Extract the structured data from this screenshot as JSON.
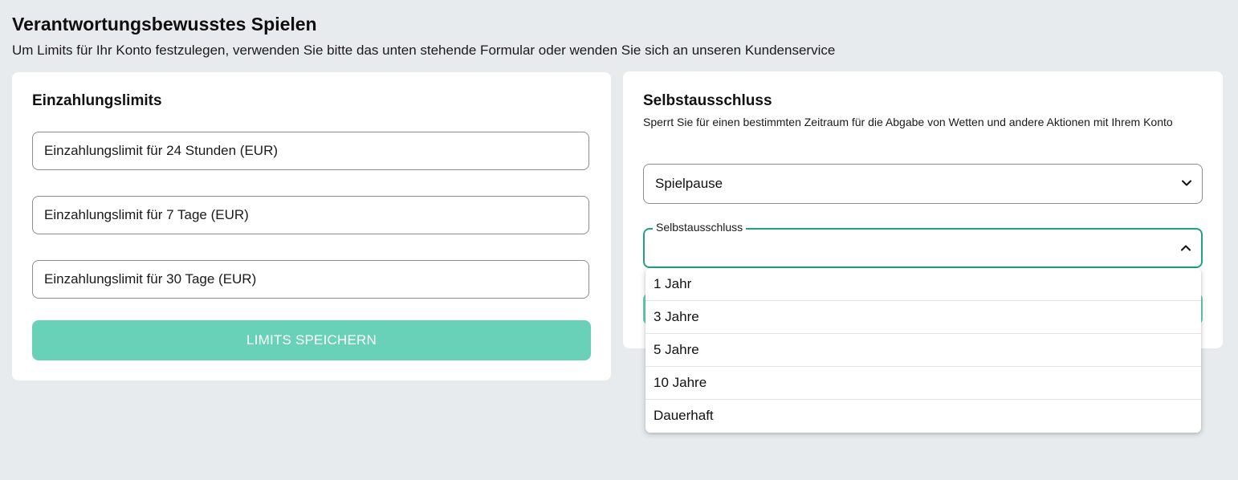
{
  "page": {
    "title": "Verantwortungsbewusstes Spielen",
    "subtitle": "Um Limits für Ihr Konto festzulegen, verwenden Sie bitte das unten stehende Formular oder wenden Sie sich an unseren Kundenservice"
  },
  "deposit_limits": {
    "title": "Einzahlungslimits",
    "fields": [
      {
        "placeholder": "Einzahlungslimit für 24 Stunden (EUR)",
        "value": ""
      },
      {
        "placeholder": "Einzahlungslimit für 7 Tage (EUR)",
        "value": ""
      },
      {
        "placeholder": "Einzahlungslimit für 30 Tage (EUR)",
        "value": ""
      }
    ],
    "save_label": "LIMITS SPEICHERN"
  },
  "self_exclusion": {
    "title": "Selbstausschluss",
    "description": "Sperrt Sie für einen bestimmten Zeitraum für die Abgabe von Wetten und andere Aktionen mit Ihrem Konto",
    "type_select": {
      "selected": "Spielpause"
    },
    "period_select": {
      "label": "Selbstausschluss",
      "selected": "",
      "open": true,
      "options": [
        "1 Jahr",
        "3 Jahre",
        "5 Jahre",
        "10 Jahre",
        "Dauerhaft"
      ]
    }
  },
  "colors": {
    "background": "#e8ebee",
    "accent": "#21a383",
    "button_disabled": "#68d1b7"
  },
  "icons": {
    "type_select_arrow": "chevron-down-icon",
    "period_select_arrow": "chevron-up-icon"
  }
}
